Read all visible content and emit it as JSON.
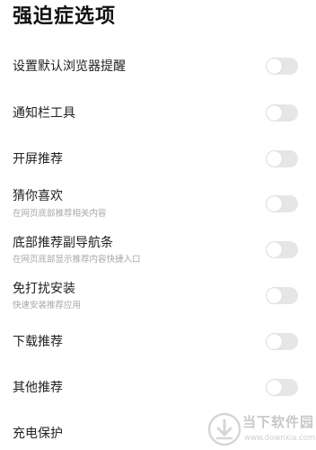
{
  "page": {
    "title": "强迫症选项"
  },
  "settings": [
    {
      "label": "设置默认浏览器提醒",
      "sub": "",
      "enabled": false
    },
    {
      "label": "通知栏工具",
      "sub": "",
      "enabled": false
    },
    {
      "label": "开屏推荐",
      "sub": "",
      "enabled": false
    },
    {
      "label": "猜你喜欢",
      "sub": "在网页底部推荐相关内容",
      "enabled": false
    },
    {
      "label": "底部推荐副导航条",
      "sub": "在网页底部显示推荐内容快捷入口",
      "enabled": false
    },
    {
      "label": "免打扰安装",
      "sub": "快速安装推荐应用",
      "enabled": false
    },
    {
      "label": "下载推荐",
      "sub": "",
      "enabled": false
    },
    {
      "label": "其他推荐",
      "sub": "",
      "enabled": false
    },
    {
      "label": "充电保护",
      "sub": "",
      "enabled": false
    }
  ],
  "watermark": {
    "name": "当下软件园",
    "url": "www.downxia.com",
    "icon": "downxia-logo-icon"
  },
  "colors": {
    "toggle_off": "#e6e6e6",
    "text_primary": "#222222",
    "text_secondary": "#a6a6a6"
  }
}
